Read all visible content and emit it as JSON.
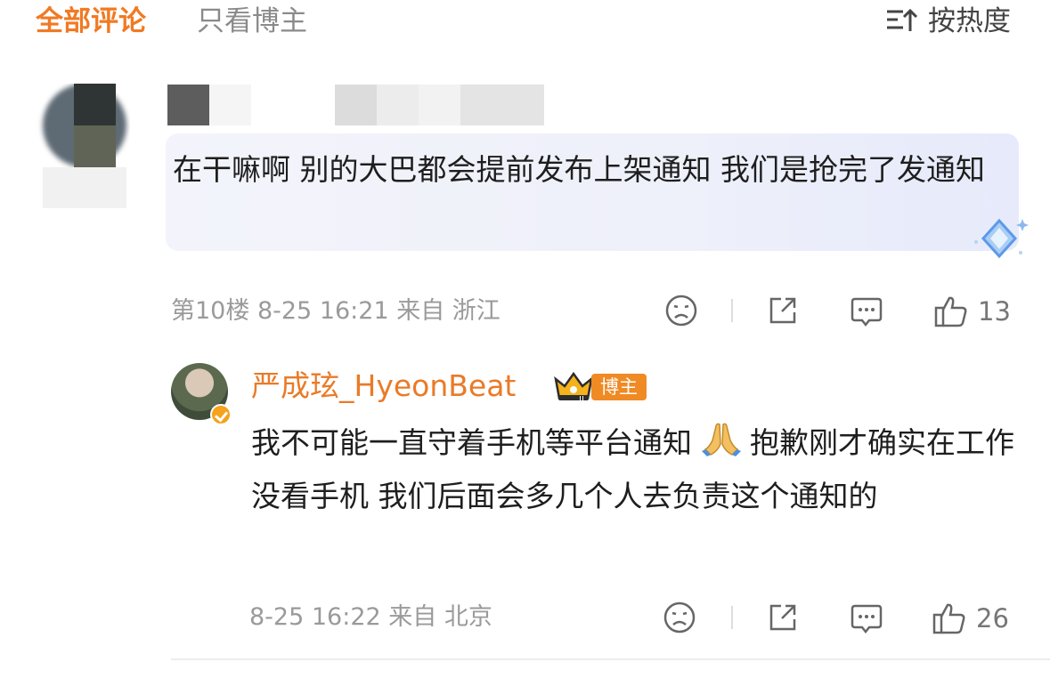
{
  "tabs": {
    "all_comments": "全部评论",
    "blogger_only": "只看博主",
    "sort_label": "按热度",
    "sort_icon": "sort-icon"
  },
  "comment": {
    "text": "在干嘛啊 别的大巴都会提前发布上架通知 我们是抢完了发通知",
    "floor": "第10楼",
    "time": "8-25 16:21",
    "location": "来自 浙江",
    "like_count": "13"
  },
  "reply": {
    "author": "严成玹_HyeonBeat",
    "tag": "博主",
    "text_part1": "我不可能一直守着手机等平台通知",
    "text_part2": "抱歉刚才确实在工作没看手机 我们后面会多几个人去负责这个通知的",
    "time": "8-25 16:22",
    "location": "来自 北京",
    "like_count": "26"
  },
  "colors": {
    "accent": "#f07a23",
    "author": "#ea7a27",
    "tag_bg": "#f08a24",
    "muted": "#9a9a9a"
  }
}
